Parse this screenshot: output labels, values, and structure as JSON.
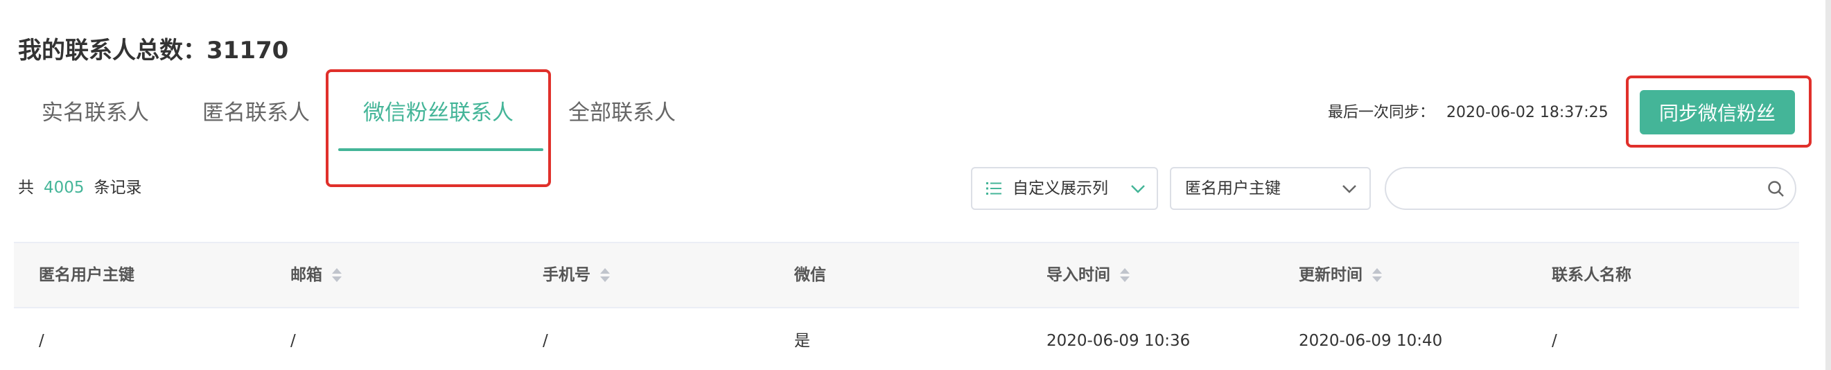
{
  "header": {
    "title": "我的联系人总数：31170"
  },
  "tabs": [
    {
      "label": "实名联系人",
      "active": false
    },
    {
      "label": "匿名联系人",
      "active": false
    },
    {
      "label": "微信粉丝联系人",
      "active": true
    },
    {
      "label": "全部联系人",
      "active": false
    }
  ],
  "sync": {
    "label": "最后一次同步：",
    "time": "2020-06-02 18:37:25",
    "button_label": "同步微信粉丝"
  },
  "records": {
    "prefix": "共",
    "count": "4005",
    "suffix": "条记录"
  },
  "toolbar": {
    "columns_button_label": "自定义展示列",
    "columns_icon": "list-icon",
    "key_select_value": "匿名用户主键",
    "search_placeholder": "",
    "search_icon": "search-icon"
  },
  "table": {
    "columns": [
      {
        "label": "匿名用户主键",
        "sortable": false
      },
      {
        "label": "邮箱",
        "sortable": true
      },
      {
        "label": "手机号",
        "sortable": true
      },
      {
        "label": "微信",
        "sortable": false
      },
      {
        "label": "导入时间",
        "sortable": true
      },
      {
        "label": "更新时间",
        "sortable": true
      },
      {
        "label": "联系人名称",
        "sortable": false
      }
    ],
    "rows": [
      [
        "/",
        "/",
        "/",
        "是",
        "2020-06-09 10:36",
        "2020-06-09 10:40",
        "/"
      ]
    ]
  },
  "colors": {
    "accent": "#44b598",
    "highlight_border": "#e0302b"
  }
}
